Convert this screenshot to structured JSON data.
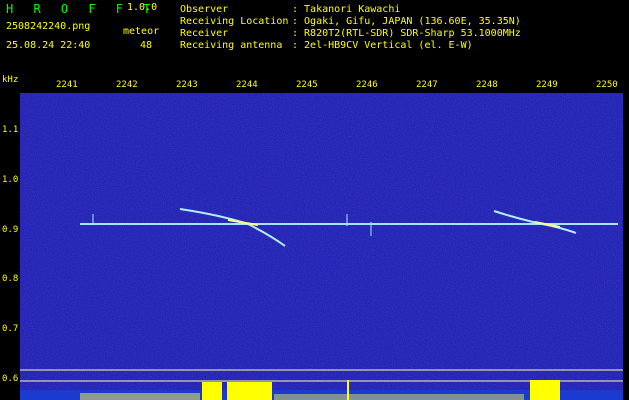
{
  "header": {
    "app_title": "H R O F F T",
    "version": "1.0.0",
    "filename": "2508242240.png",
    "datetime": "25.08.24 22:40",
    "meteor_label": "meteor",
    "meteor_count": "48"
  },
  "station": {
    "rows": [
      {
        "label": "Observer",
        "value": ": Takanori Kawachi"
      },
      {
        "label": "Receiving Location",
        "value": ": Ogaki, Gifu, JAPAN (136.60E, 35.35N)"
      },
      {
        "label": "Receiver",
        "value": ": R820T2(RTL-SDR) SDR-Sharp 53.1000MHz"
      },
      {
        "label": "Receiving antenna",
        "value": ": 2el-HB9CV Vertical (el. E-W)"
      }
    ]
  },
  "axes": {
    "unit": "kHz",
    "x_ticks": [
      "2241",
      "2242",
      "2243",
      "2244",
      "2245",
      "2246",
      "2247",
      "2248",
      "2249",
      "2250"
    ],
    "y_ticks": [
      "1.1",
      "1.0",
      "0.9",
      "0.8",
      "0.7",
      "0.6"
    ]
  },
  "colors": {
    "background": "#10109a",
    "trace": "#9fe8ff",
    "accent": "#ffff00",
    "title": "#00ff00"
  }
}
